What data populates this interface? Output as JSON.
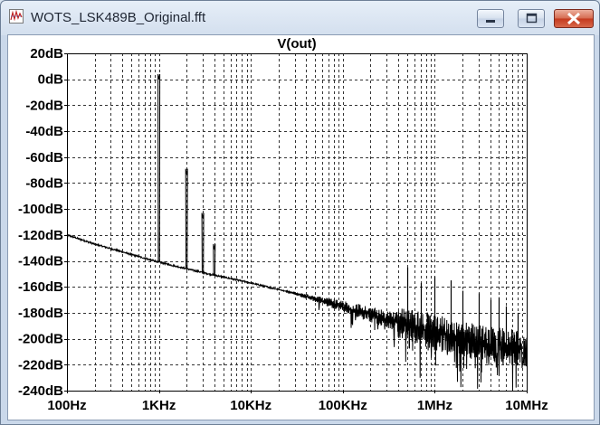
{
  "window": {
    "title": "WOTS_LSK489B_Original.fft",
    "close_color": "#c4391d"
  },
  "chart_data": {
    "type": "line",
    "title": "V(out)",
    "x_scale": "log",
    "xlim_hz": [
      100,
      10000000
    ],
    "ylim_db": [
      -240,
      20
    ],
    "x_tick_labels": [
      "100Hz",
      "1KHz",
      "10KHz",
      "100KHz",
      "1MHz",
      "10MHz"
    ],
    "x_tick_values": [
      100,
      1000,
      10000,
      100000,
      1000000,
      10000000
    ],
    "y_tick_labels": [
      "20dB",
      "0dB",
      "-20dB",
      "-40dB",
      "-60dB",
      "-80dB",
      "-100dB",
      "-120dB",
      "-140dB",
      "-160dB",
      "-180dB",
      "-200dB",
      "-220dB",
      "-240dB"
    ],
    "y_tick_values": [
      20,
      0,
      -20,
      -40,
      -60,
      -80,
      -100,
      -120,
      -140,
      -160,
      -180,
      -200,
      -220,
      -240
    ],
    "grid": "dashed",
    "series": [
      {
        "noise_floor": [
          [
            100,
            -120
          ],
          [
            200,
            -127
          ],
          [
            500,
            -135
          ],
          [
            1000,
            -141
          ],
          [
            3000,
            -149
          ],
          [
            10000,
            -157
          ],
          [
            30000,
            -165
          ],
          [
            100000,
            -175
          ],
          [
            300000,
            -185
          ],
          [
            1000000,
            -195
          ],
          [
            3000000,
            -203
          ],
          [
            10000000,
            -208
          ]
        ],
        "harmonics": [
          [
            1000,
            0
          ],
          [
            2000,
            -73
          ],
          [
            3000,
            -107
          ],
          [
            4000,
            -131
          ]
        ],
        "spurs": [
          [
            500000,
            -145
          ],
          [
            700000,
            -157
          ],
          [
            1000000,
            -152
          ],
          [
            1500000,
            -155
          ],
          [
            2000000,
            -163
          ],
          [
            3000000,
            -165
          ],
          [
            4000000,
            -170
          ],
          [
            5000000,
            -168
          ],
          [
            6000000,
            -175
          ],
          [
            8000000,
            -180
          ]
        ]
      }
    ]
  }
}
